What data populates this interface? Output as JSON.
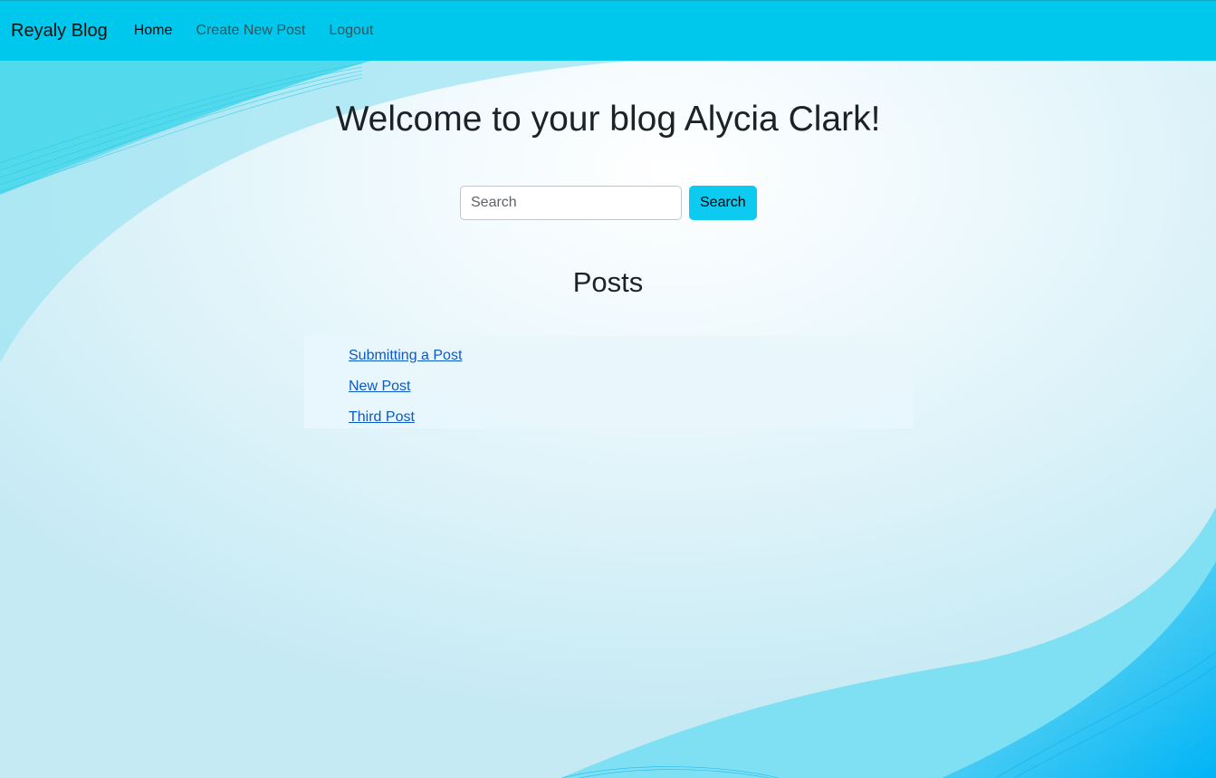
{
  "navbar": {
    "brand": "Reyaly Blog",
    "links": [
      {
        "label": "Home",
        "active": true
      },
      {
        "label": "Create New Post",
        "active": false
      },
      {
        "label": "Logout",
        "active": false
      }
    ],
    "color": "#00c8ec"
  },
  "main": {
    "heading": "Welcome to your blog Alycia Clark!",
    "search": {
      "placeholder": "Search",
      "value": "",
      "button_label": "Search"
    },
    "posts_heading": "Posts",
    "posts": [
      {
        "title": "Submitting a Post"
      },
      {
        "title": "New Post"
      },
      {
        "title": "Third Post"
      }
    ]
  },
  "colors": {
    "accent": "#0dcaf0",
    "link": "#0a58ca",
    "background": "#c6eaf4"
  }
}
